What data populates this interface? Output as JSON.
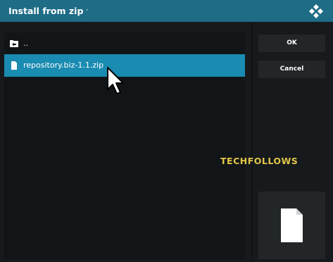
{
  "dialog": {
    "title": "Install from zip file",
    "logo_icon": "kodi-logo-icon"
  },
  "file_list": {
    "items": [
      {
        "label": "..",
        "icon": "parent-folder-icon",
        "selected": false
      },
      {
        "label": "repository.biz-1.1.zip",
        "icon": "file-icon",
        "selected": true
      }
    ]
  },
  "buttons": {
    "ok_label": "OK",
    "cancel_label": "Cancel"
  },
  "preview": {
    "icon": "file-icon"
  },
  "watermark": {
    "text": "TECHFOLLOWS"
  },
  "colors": {
    "title_bar": "#1e6c86",
    "selection": "#1a8bb1",
    "background": "#161a1d",
    "panel": "#121517",
    "button": "#222629",
    "watermark": "#e3c649"
  }
}
